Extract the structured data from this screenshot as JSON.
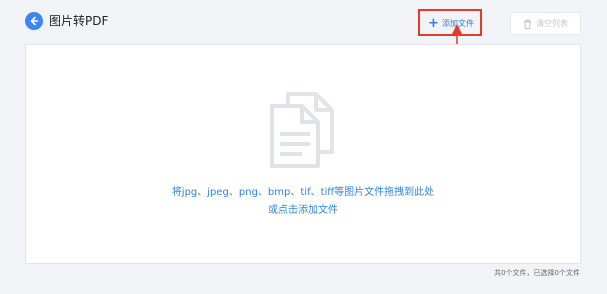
{
  "header": {
    "title": "图片转PDF",
    "back_icon": "arrow-left-icon",
    "accent_color": "#3b87f2"
  },
  "toolbar": {
    "add_label": "添加文件",
    "add_icon": "plus-icon",
    "clear_label": "清空列表",
    "clear_icon": "trash-icon",
    "highlight_color": "#e23b2e"
  },
  "dropzone": {
    "icon": "documents-icon",
    "hint_line1": "将jpg、jpeg、png、bmp、tif、tiff等图片文件拖拽到此处",
    "hint_line2": "或点击添加文件",
    "hint_color": "#2f86d8"
  },
  "status": {
    "text": "共0个文件，已选择0个文件"
  }
}
